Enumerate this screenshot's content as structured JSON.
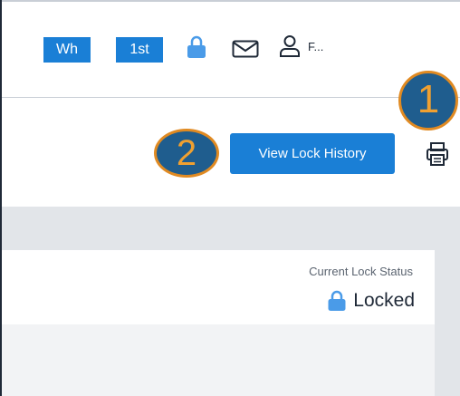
{
  "header": {
    "tag_wh": "Wh",
    "tag_1st": "1st",
    "user_initial": "F...",
    "icons": [
      "lock-icon",
      "mail-icon",
      "user-icon"
    ]
  },
  "annotations": {
    "marker_1": "1",
    "marker_2": "2"
  },
  "actions": {
    "view_lock_history": "View Lock History",
    "print_icon": "printer-icon"
  },
  "lock_status": {
    "label": "Current Lock Status",
    "value": "Locked",
    "icon": "lock-icon"
  },
  "colors": {
    "accent": "#1a7fd6",
    "lock_icon": "#4a9be8",
    "badge_fill": "#1f5d8e",
    "badge_border": "#e08a22"
  }
}
